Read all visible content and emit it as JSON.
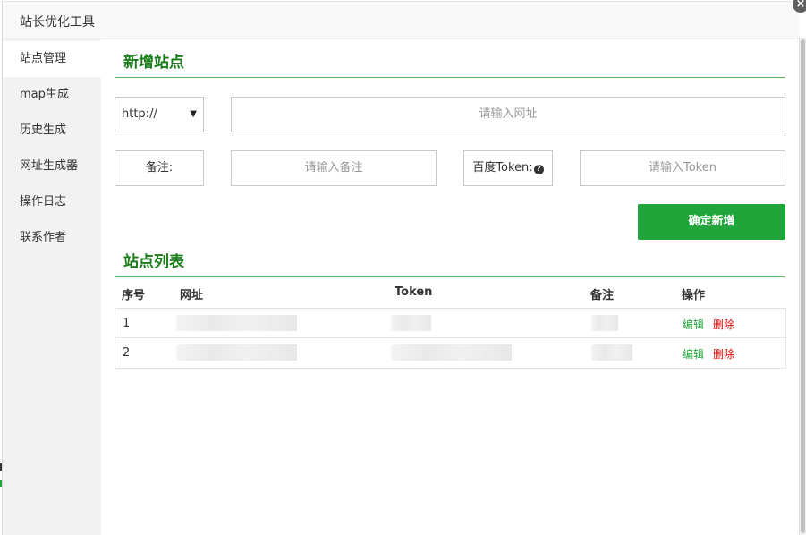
{
  "window": {
    "title": "站长优化工具",
    "close": "×"
  },
  "sidebar": {
    "items": [
      {
        "label": "站点管理",
        "active": true
      },
      {
        "label": "map生成"
      },
      {
        "label": "历史生成"
      },
      {
        "label": "网址生成器"
      },
      {
        "label": "操作日志"
      },
      {
        "label": "联系作者"
      }
    ]
  },
  "add_section": {
    "title": "新增站点",
    "protocol_select": {
      "value": "http://",
      "caret": "▼"
    },
    "url_input": {
      "placeholder": "请输入网址"
    },
    "remark_label": "备注:",
    "remark_input": {
      "placeholder": "请输入备注"
    },
    "token_label": "百度Token:",
    "token_help_icon": "?",
    "token_input": {
      "placeholder": "请输入Token"
    },
    "confirm_button": "确定新增"
  },
  "list_section": {
    "title": "站点列表",
    "columns": [
      "序号",
      "网址",
      "Token",
      "备注",
      "操作"
    ],
    "rows": [
      {
        "index": "1",
        "edit": "编辑",
        "delete": "删除"
      },
      {
        "index": "2",
        "edit": "编辑",
        "delete": "删除"
      }
    ]
  },
  "colors": {
    "accent": "#20a53a",
    "title_green": "#1a7d1a",
    "danger": "#e00000"
  }
}
